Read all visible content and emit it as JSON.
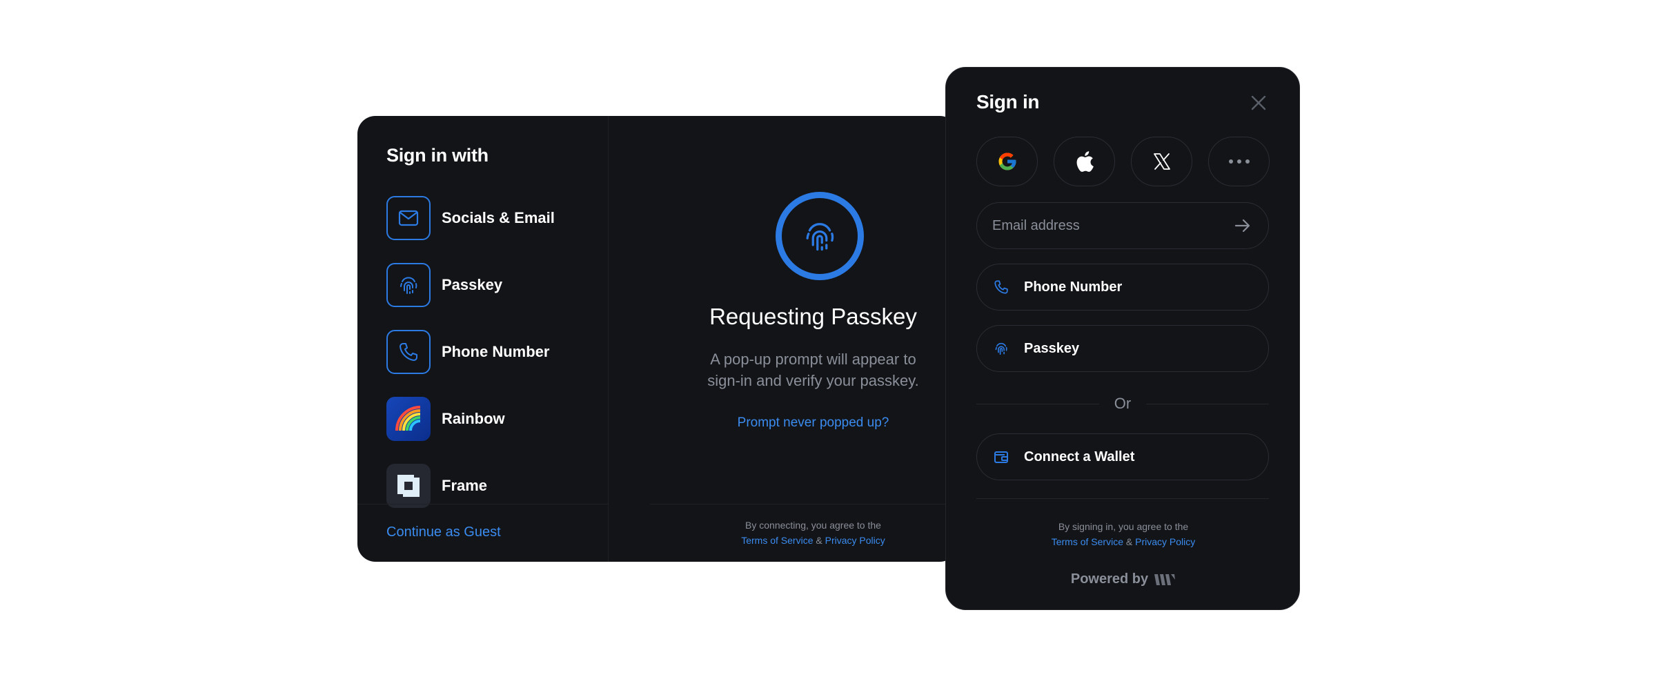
{
  "wide_modal": {
    "title": "Sign in with",
    "options": [
      {
        "label": "Socials & Email",
        "icon": "mail-icon"
      },
      {
        "label": "Passkey",
        "icon": "fingerprint-icon"
      },
      {
        "label": "Phone Number",
        "icon": "phone-icon"
      },
      {
        "label": "Rainbow",
        "icon": "rainbow-logo-icon"
      },
      {
        "label": "Frame",
        "icon": "frame-logo-icon"
      }
    ],
    "guest_link": "Continue as Guest",
    "detail": {
      "title": "Requesting Passkey",
      "description": "A pop-up prompt will appear to sign-in and verify your passkey.",
      "help_link": "Prompt never popped up?",
      "legal_prefix": "By connecting, you agree to the",
      "terms": "Terms of Service",
      "amp": "&",
      "privacy": "Privacy Policy"
    }
  },
  "compact_modal": {
    "title": "Sign in",
    "socials": [
      "google-icon",
      "apple-icon",
      "x-icon",
      "more-icon"
    ],
    "email_placeholder": "Email address",
    "phone_label": "Phone Number",
    "passkey_label": "Passkey",
    "or_text": "Or",
    "wallet_label": "Connect a Wallet",
    "legal_prefix": "By signing in, you agree to the",
    "terms": "Terms of Service",
    "amp": "&",
    "privacy": "Privacy Policy",
    "powered_by": "Powered by"
  },
  "colors": {
    "accent": "#2c7be5",
    "link": "#3b8cf0",
    "panel": "#131418",
    "muted": "#8a8f99"
  }
}
